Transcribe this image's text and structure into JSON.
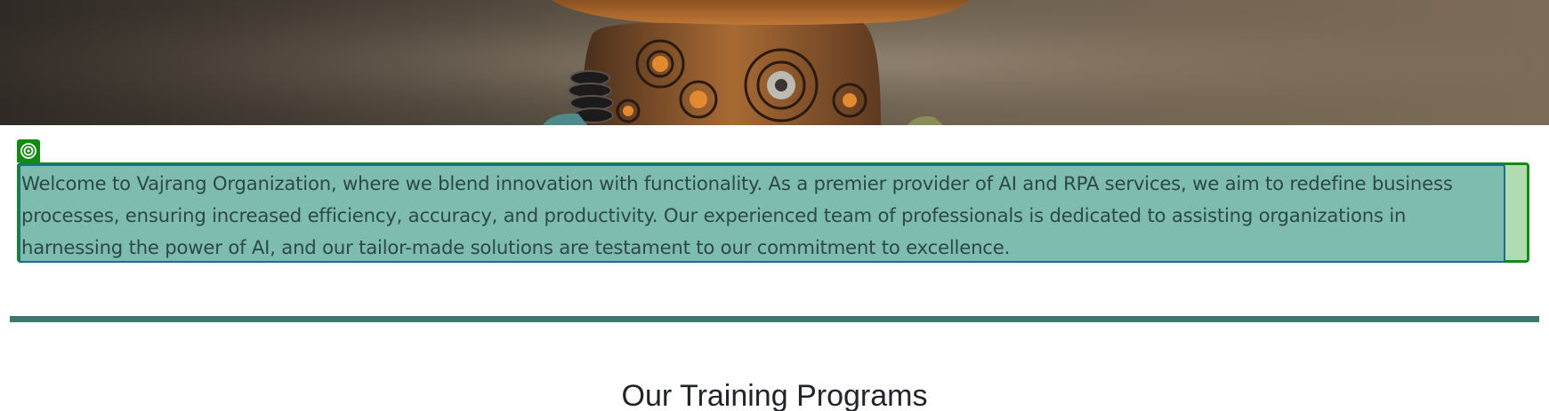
{
  "intro": {
    "text": "Welcome to Vajrang Organization, where we blend innovation with functionality. As a premier provider of AI and RPA services, we aim to redefine business processes, ensuring increased efficiency, accuracy, and productivity. Our experienced team of professionals is dedicated to assisting organizations in harnessing the power of AI, and our tailor-made solutions are testament to our commitment to excellence."
  },
  "programs": {
    "title": "Our Training Programs"
  },
  "icons": {
    "hero": "robot-hero-image",
    "edit": "target-icon"
  },
  "colors": {
    "selection_outer": "#138a13",
    "selection_fill": "#7dbcae",
    "divider": "#3e776d"
  }
}
